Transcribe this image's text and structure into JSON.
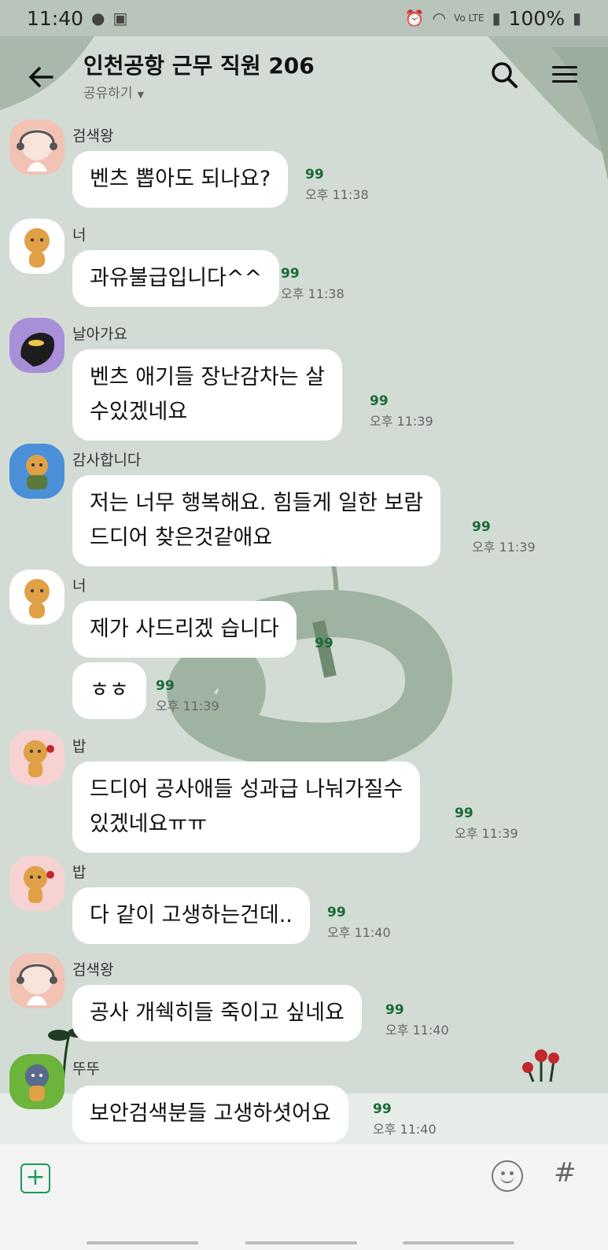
{
  "status_bar": {
    "time": "11:40",
    "network": "Vo LTE",
    "battery": "100%"
  },
  "chat": {
    "title": "인천공항 근무 직원 206",
    "share_label": "공유하기"
  },
  "messages": [
    {
      "sender": "검색왕",
      "text_lines": [
        "벤츠 뽑아도 되나요?"
      ],
      "read_count": "99",
      "time": "오후 11:38",
      "avatar": "woman-headset"
    },
    {
      "sender": "너",
      "text_lines": [
        "과유불급입니다^^"
      ],
      "read_count": "99",
      "time": "오후 11:38",
      "avatar": "ryan-bear"
    },
    {
      "sender": "날아가요",
      "text_lines": [
        "벤츠 애기들 장난감차는 살",
        "수있겠네요"
      ],
      "read_count": "99",
      "time": "오후 11:39",
      "avatar": "dark-character"
    },
    {
      "sender": "감사합니다",
      "text_lines": [
        "저는 너무 행복해요. 힘들게 일한 보람",
        "드디어 찾은것같애요"
      ],
      "read_count": "99",
      "time": "오후 11:39",
      "avatar": "ryan-bear-blue"
    },
    {
      "sender": "너",
      "text_lines": [
        "제가 사드리겠 습니다"
      ],
      "read_count": "99",
      "time": "",
      "avatar": "ryan-bear"
    },
    {
      "sender": "",
      "text_lines": [
        "ㅎㅎ"
      ],
      "read_count": "99",
      "time": "오후 11:39",
      "avatar": ""
    },
    {
      "sender": "밥",
      "text_lines": [
        "드디어 공사애들 성과급 나눠가질수",
        "있겠네요ㅠㅠ"
      ],
      "read_count": "99",
      "time": "오후 11:39",
      "avatar": "ryan-bear-pink"
    },
    {
      "sender": "밥",
      "text_lines": [
        "다 같이 고생하는건데.."
      ],
      "read_count": "99",
      "time": "오후 11:40",
      "avatar": "ryan-bear-pink"
    },
    {
      "sender": "검색왕",
      "text_lines": [
        "공사 개쉑히들 죽이고 싶네요"
      ],
      "read_count": "99",
      "time": "오후 11:40",
      "avatar": "woman-headset"
    },
    {
      "sender": "뚜뚜",
      "text_lines": [
        "보안검색분들 고생하셧어요"
      ],
      "read_count": "99",
      "time": "오후 11:40",
      "avatar": "ryan-bear-green"
    }
  ],
  "input_bar": {
    "plus_icon": "plus-icon",
    "emoji_icon": "emoji-icon",
    "hash_label": "#"
  },
  "colors": {
    "background": "#d2dcd4",
    "bubble": "#ffffff",
    "read_count": "#1a6b34",
    "accent": "#1b9a5a"
  }
}
